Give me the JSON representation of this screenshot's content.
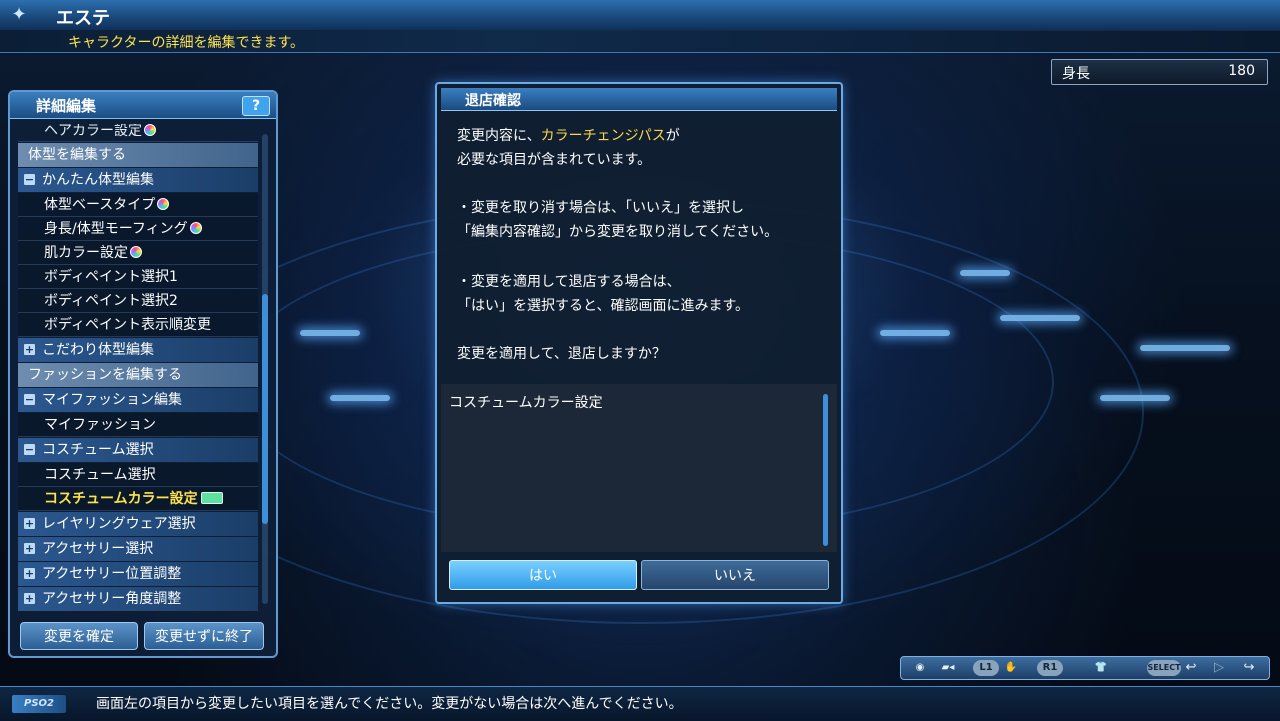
{
  "header": {
    "title": "エステ",
    "subtitle": "キャラクターの詳細を編集できます。"
  },
  "height_field": {
    "label": "身長",
    "value": "180"
  },
  "left_panel": {
    "title": "詳細編集",
    "help_label": "?",
    "items": [
      {
        "type": "partial",
        "label": "ヘアカラー設定",
        "icon": "pass"
      },
      {
        "type": "section",
        "label": "体型を編集する"
      },
      {
        "type": "group",
        "label": "かんたん体型編集",
        "toggle": "−"
      },
      {
        "type": "leaf",
        "label": "体型ベースタイプ",
        "icon": "pass"
      },
      {
        "type": "leaf",
        "label": "身長/体型モーフィング",
        "icon": "pass"
      },
      {
        "type": "leaf",
        "label": "肌カラー設定",
        "icon": "pass"
      },
      {
        "type": "leaf",
        "label": "ボディペイント選択1"
      },
      {
        "type": "leaf",
        "label": "ボディペイント選択2"
      },
      {
        "type": "leaf",
        "label": "ボディペイント表示順変更"
      },
      {
        "type": "group",
        "label": "こだわり体型編集",
        "toggle": "+"
      },
      {
        "type": "section",
        "label": "ファッションを編集する"
      },
      {
        "type": "group",
        "label": "マイファッション編集",
        "toggle": "−"
      },
      {
        "type": "leaf",
        "label": "マイファッション"
      },
      {
        "type": "group",
        "label": "コスチューム選択",
        "toggle": "−"
      },
      {
        "type": "leaf",
        "label": "コスチューム選択"
      },
      {
        "type": "leaf",
        "label": "コスチュームカラー設定",
        "icon": "ticket",
        "active": true
      },
      {
        "type": "group",
        "label": "レイヤリングウェア選択",
        "toggle": "+"
      },
      {
        "type": "group",
        "label": "アクセサリー選択",
        "toggle": "+"
      },
      {
        "type": "group",
        "label": "アクセサリー位置調整",
        "toggle": "+"
      },
      {
        "type": "group",
        "label": "アクセサリー角度調整",
        "toggle": "+"
      }
    ],
    "confirm_label": "変更を確定",
    "cancel_label": "変更せずに終了"
  },
  "dialog": {
    "title": "退店確認",
    "line1_pre": "変更内容に、",
    "line1_hl": "カラーチェンジパス",
    "line1_post": "が",
    "line2": "必要な項目が含まれています。",
    "line3": "・変更を取り消す場合は、「いいえ」を選択し",
    "line4": "「編集内容確認」から変更を取り消してください。",
    "line5": "・変更を適用して退店する場合は、",
    "line6": "「はい」を選択すると、確認画面に進みます。",
    "line7": "変更を適用して、退店しますか？",
    "list_item": "コスチュームカラー設定",
    "yes_label": "はい",
    "no_label": "いいえ"
  },
  "controls": {
    "l1": "L1",
    "r1": "R1",
    "select": "SELECT"
  },
  "status": {
    "message": "画面左の項目から変更したい項目を選んでください。変更がない場合は次へ進んでください。"
  },
  "colors": {
    "accent_blue": "#3d8fd9",
    "highlight_yellow": "#ffd84a",
    "subtitle_yellow": "#ffe34a"
  }
}
